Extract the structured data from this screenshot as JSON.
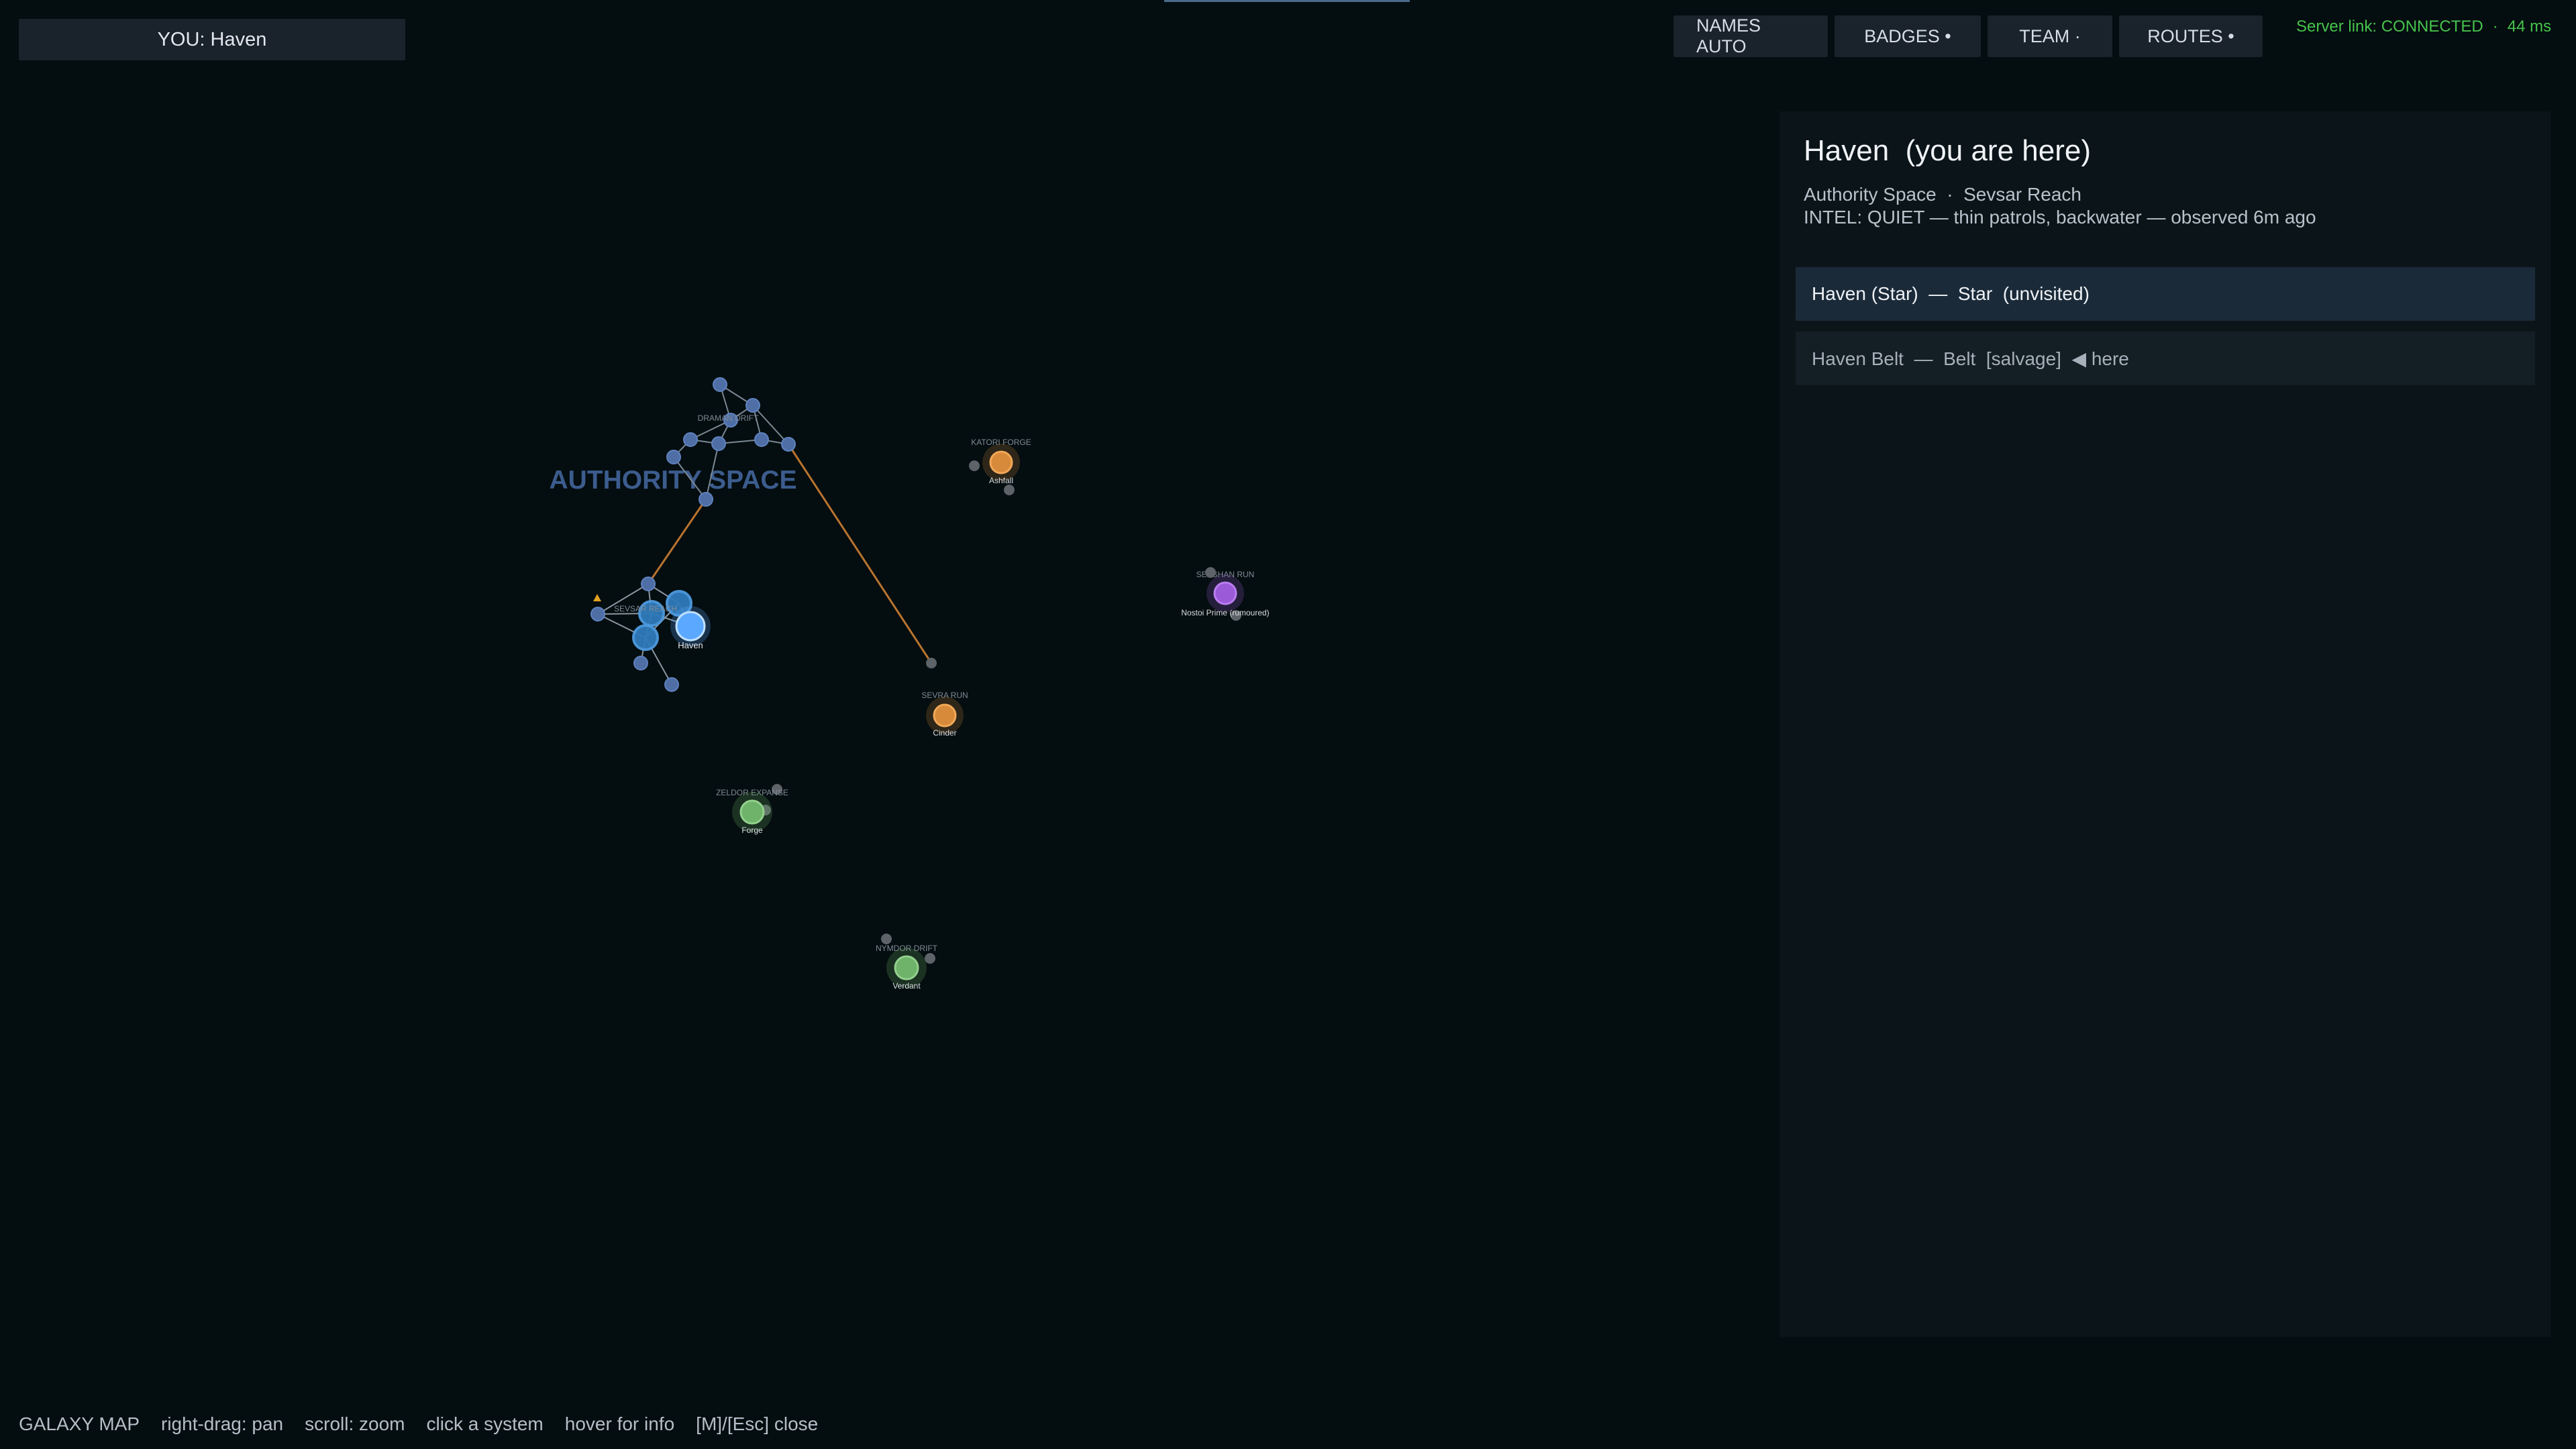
{
  "location_badge": "YOU: Haven",
  "toolbar": {
    "names": "NAMES AUTO",
    "badges": "BADGES •",
    "team": "TEAM ·",
    "routes": "ROUTES •"
  },
  "status": {
    "link": "Server link: CONNECTED",
    "separator": "·",
    "ping": "44 ms"
  },
  "colors": {
    "background": "#040d0f",
    "authority": "#5b7fb8",
    "current": "#5aa8ff",
    "orange": "#d68a3a",
    "purple": "#9b5bd8",
    "green": "#6fb26a",
    "neutral": "#6d737a",
    "route": "#b8732f",
    "status_ok": "#46c34c"
  },
  "map": {
    "region_label": "AUTHORITY SPACE",
    "clusters": [
      {
        "label": "DRAMAN DRIFT"
      },
      {
        "label": "SEVSAR REACH"
      },
      {
        "label": "KATORI FORGE"
      },
      {
        "label": "SEVSHAN RUN"
      },
      {
        "label": "SEVRA RUN"
      },
      {
        "label": "ZELDOR EXPANSE"
      },
      {
        "label": "NYMDOR DRIFT"
      }
    ],
    "systems": [
      {
        "name": "Haven",
        "kind": "current"
      },
      {
        "name": "Ashfall",
        "kind": "orange"
      },
      {
        "name": "Nostoi Prime (rumoured)",
        "kind": "purple"
      },
      {
        "name": "Cinder",
        "kind": "orange"
      },
      {
        "name": "Forge",
        "kind": "green"
      },
      {
        "name": "Verdant",
        "kind": "green"
      }
    ]
  },
  "panel": {
    "title": "Haven  (you are here)",
    "subtitle": "Authority Space  ·  Sevsar Reach",
    "intel": "INTEL: QUIET — thin patrols, backwater — observed 6m ago",
    "bodies": [
      {
        "label": "Haven (Star)  —  Star  (unvisited)"
      },
      {
        "label": "Haven Belt  —  Belt  [salvage]  ◀ here"
      }
    ]
  },
  "hints": [
    "GALAXY MAP",
    "right-drag: pan",
    "scroll: zoom",
    "click a system",
    "hover for info",
    "[M]/[Esc] close"
  ]
}
